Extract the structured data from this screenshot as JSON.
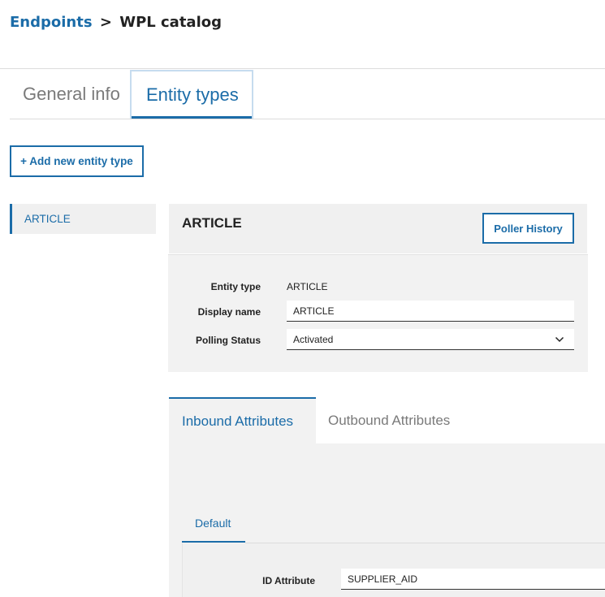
{
  "breadcrumb": {
    "parent": "Endpoints",
    "separator": ">",
    "current": "WPL catalog"
  },
  "main_tabs": [
    {
      "label": "General info",
      "active": false
    },
    {
      "label": "Entity types",
      "active": true
    }
  ],
  "add_button": "+ Add new entity type",
  "sidebar": {
    "items": [
      {
        "label": "ARTICLE",
        "selected": true
      }
    ]
  },
  "panel": {
    "title": "ARTICLE",
    "poller_button": "Poller History",
    "fields": {
      "entity_type": {
        "label": "Entity type",
        "value": "ARTICLE"
      },
      "display_name": {
        "label": "Display name",
        "value": "ARTICLE"
      },
      "polling_status": {
        "label": "Polling Status",
        "value": "Activated"
      }
    }
  },
  "attr_tabs": [
    {
      "label": "Inbound Attributes",
      "active": true
    },
    {
      "label": "Outbound Attributes",
      "active": false
    }
  ],
  "inner_tabs": [
    {
      "label": "Default",
      "active": true
    }
  ],
  "id_attribute": {
    "label": "ID Attribute",
    "value": "SUPPLIER_AID"
  },
  "colors": {
    "accent": "#1b6ca8",
    "panel_bg": "#f0f0f0"
  }
}
